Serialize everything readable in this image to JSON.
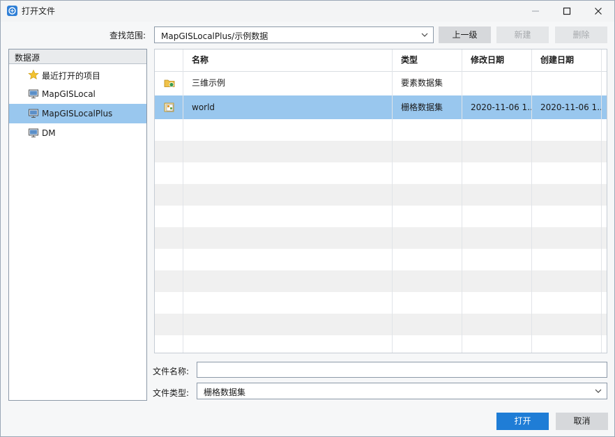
{
  "window": {
    "title": "打开文件",
    "accent": "#1f7dd6",
    "selection": "#99c7ee"
  },
  "toolbar": {
    "lookin_label": "查找范围:",
    "lookin_value": "MapGISLocalPlus/示例数据",
    "up_label": "上一级",
    "new_label": "新建",
    "delete_label": "删除"
  },
  "sidebar": {
    "header": "数据源",
    "items": [
      {
        "label": "最近打开的项目",
        "icon": "star-icon",
        "selected": false
      },
      {
        "label": "MapGISLocal",
        "icon": "computer-icon",
        "selected": false
      },
      {
        "label": "MapGISLocalPlus",
        "icon": "computer-icon",
        "selected": true
      },
      {
        "label": "DM",
        "icon": "computer-icon",
        "selected": false
      }
    ]
  },
  "table": {
    "columns": [
      "名称",
      "类型",
      "修改日期",
      "创建日期"
    ],
    "rows": [
      {
        "icon": "feature-dataset-folder-icon",
        "name": "三维示例",
        "type": "要素数据集",
        "modified": "",
        "created": "",
        "selected": false
      },
      {
        "icon": "raster-dataset-icon",
        "name": "world",
        "type": "栅格数据集",
        "modified": "2020-11-06 1...",
        "created": "2020-11-06 1...",
        "selected": true
      }
    ]
  },
  "filename": {
    "label": "文件名称:",
    "value": ""
  },
  "filetype": {
    "label": "文件类型:",
    "value": "栅格数据集"
  },
  "actions": {
    "open_label": "打开",
    "cancel_label": "取消"
  }
}
